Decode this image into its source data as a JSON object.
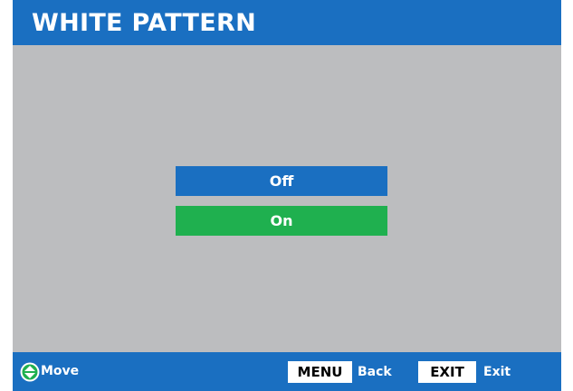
{
  "header": {
    "title": "WHITE PATTERN"
  },
  "menu": {
    "options": [
      {
        "label": "Off",
        "state": "default"
      },
      {
        "label": "On",
        "state": "selected"
      }
    ]
  },
  "footer": {
    "move": {
      "icon": "up-down-arrows-icon",
      "label": "Move"
    },
    "back": {
      "key": "MENU",
      "label": "Back"
    },
    "exit": {
      "key": "EXIT",
      "label": "Exit"
    }
  },
  "colors": {
    "bar_blue": "#1a6fc1",
    "selected_green": "#1fb04f",
    "background_gray": "#bcbdbf"
  }
}
